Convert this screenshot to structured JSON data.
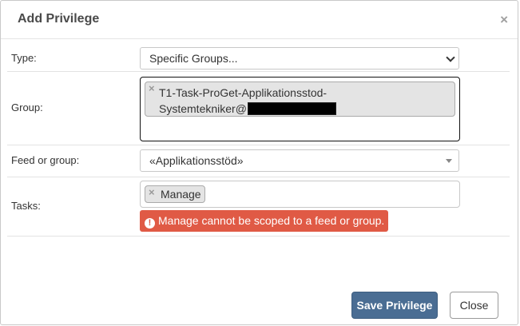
{
  "dialog": {
    "title": "Add Privilege",
    "close_glyph": "×",
    "close_icon": "close-icon"
  },
  "form": {
    "type": {
      "label": "Type:",
      "value": "Specific Groups..."
    },
    "group": {
      "label": "Group:",
      "chip_remove_glyph": "×",
      "chip_text_line1": "T1-Task-ProGet-Applikationsstod-",
      "chip_text_line2": "Systemtekniker@"
    },
    "feed": {
      "label": "Feed or group:",
      "value": "«Applikationsstöd»"
    },
    "tasks": {
      "label": "Tasks:",
      "chip_remove_glyph": "×",
      "chip_text": "Manage"
    },
    "error": {
      "icon": "exclamation-circle-icon",
      "icon_glyph": "!",
      "message": "Manage cannot be scoped to a feed or group.",
      "color": "#e05a45"
    }
  },
  "footer": {
    "save_label": "Save Privilege",
    "close_label": "Close"
  },
  "colors": {
    "primary": "#4a6d93",
    "error": "#e05a45"
  }
}
